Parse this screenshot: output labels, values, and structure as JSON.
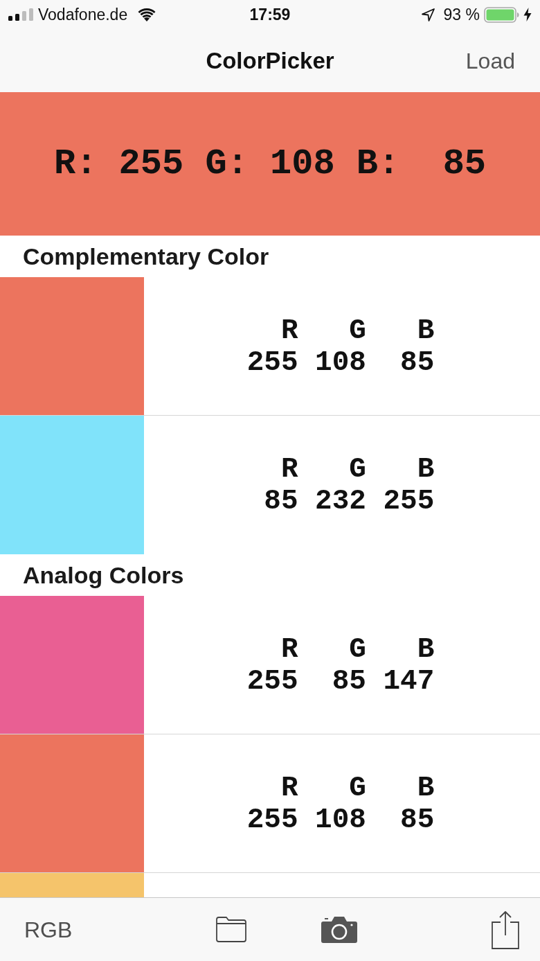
{
  "status_bar": {
    "carrier": "Vodafone.de",
    "time": "17:59",
    "battery_percent": "93 %"
  },
  "navigation_bar": {
    "title": "ColorPicker",
    "right_button": "Load"
  },
  "preview": {
    "channels": [
      {
        "label": "R:",
        "value": "255"
      },
      {
        "label": "G:",
        "value": "108"
      },
      {
        "label": "B:",
        "value": "85"
      }
    ]
  },
  "sections": [
    {
      "title": "Complementary Color",
      "swatches": [
        {
          "color": "#ec745e",
          "channels": [
            {
              "label": "R",
              "value": "255"
            },
            {
              "label": "G",
              "value": "108"
            },
            {
              "label": "B",
              "value": "85"
            }
          ]
        },
        {
          "color": "#80e3fa",
          "channels": [
            {
              "label": "R",
              "value": "85"
            },
            {
              "label": "G",
              "value": "232"
            },
            {
              "label": "B",
              "value": "255"
            }
          ]
        }
      ]
    },
    {
      "title": "Analog Colors",
      "swatches": [
        {
          "color": "#e95f93",
          "channels": [
            {
              "label": "R",
              "value": "255"
            },
            {
              "label": "G",
              "value": "85"
            },
            {
              "label": "B",
              "value": "147"
            }
          ]
        },
        {
          "color": "#ec745e",
          "channels": [
            {
              "label": "R",
              "value": "255"
            },
            {
              "label": "G",
              "value": "108"
            },
            {
              "label": "B",
              "value": "85"
            }
          ]
        },
        {
          "color": "#f5c46b"
        }
      ]
    }
  ],
  "toolbar": {
    "mode_button": "RGB"
  }
}
